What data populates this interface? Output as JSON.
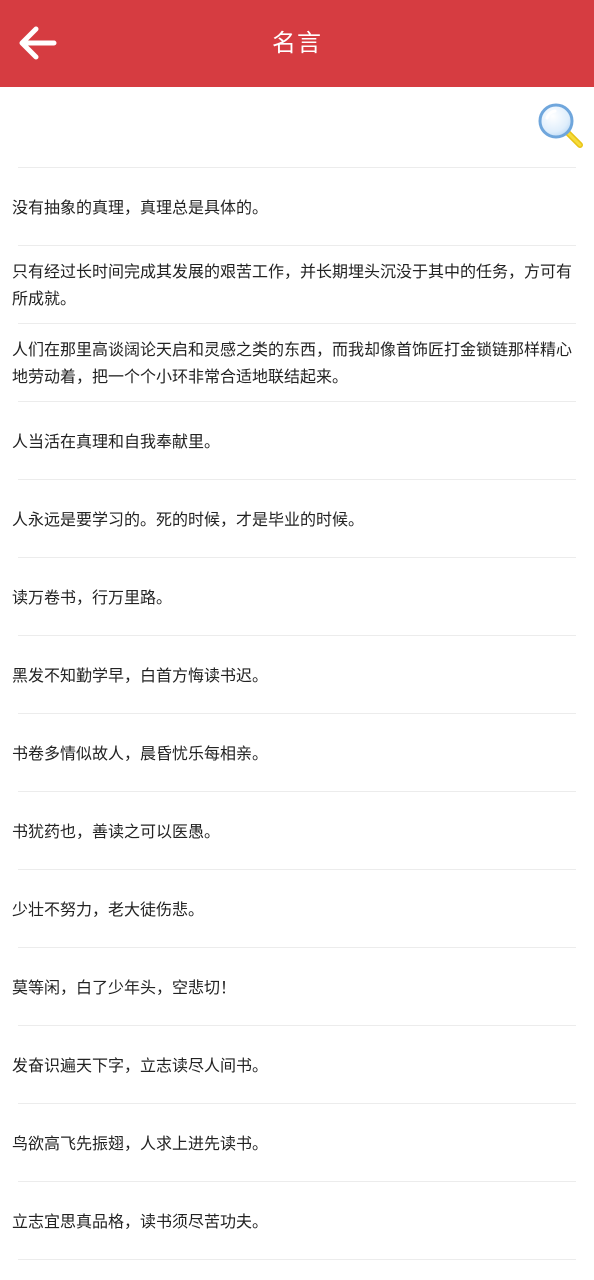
{
  "header": {
    "title": "名言",
    "colors": {
      "background": "#d63c41",
      "title": "#ffffff"
    }
  },
  "search": {
    "icon": "magnifier-icon"
  },
  "quotes": [
    "没有抽象的真理，真理总是具体的。",
    "只有经过长时间完成其发展的艰苦工作，并长期埋头沉没于其中的任务，方可有所成就。",
    "人们在那里高谈阔论天启和灵感之类的东西，而我却像首饰匠打金锁链那样精心地劳动着，把一个个小环非常合适地联结起来。",
    "人当活在真理和自我奉献里。",
    "人永远是要学习的。死的时候，才是毕业的时候。",
    "读万卷书，行万里路。",
    "黑发不知勤学早，白首方悔读书迟。",
    "书卷多情似故人，晨昏忧乐每相亲。",
    "书犹药也，善读之可以医愚。",
    "少壮不努力，老大徒伤悲。",
    "莫等闲，白了少年头，空悲切！",
    "发奋识遍天下字，立志读尽人间书。",
    "鸟欲高飞先振翅，人求上进先读书。",
    "立志宜思真品格，读书须尽苦功夫。"
  ]
}
